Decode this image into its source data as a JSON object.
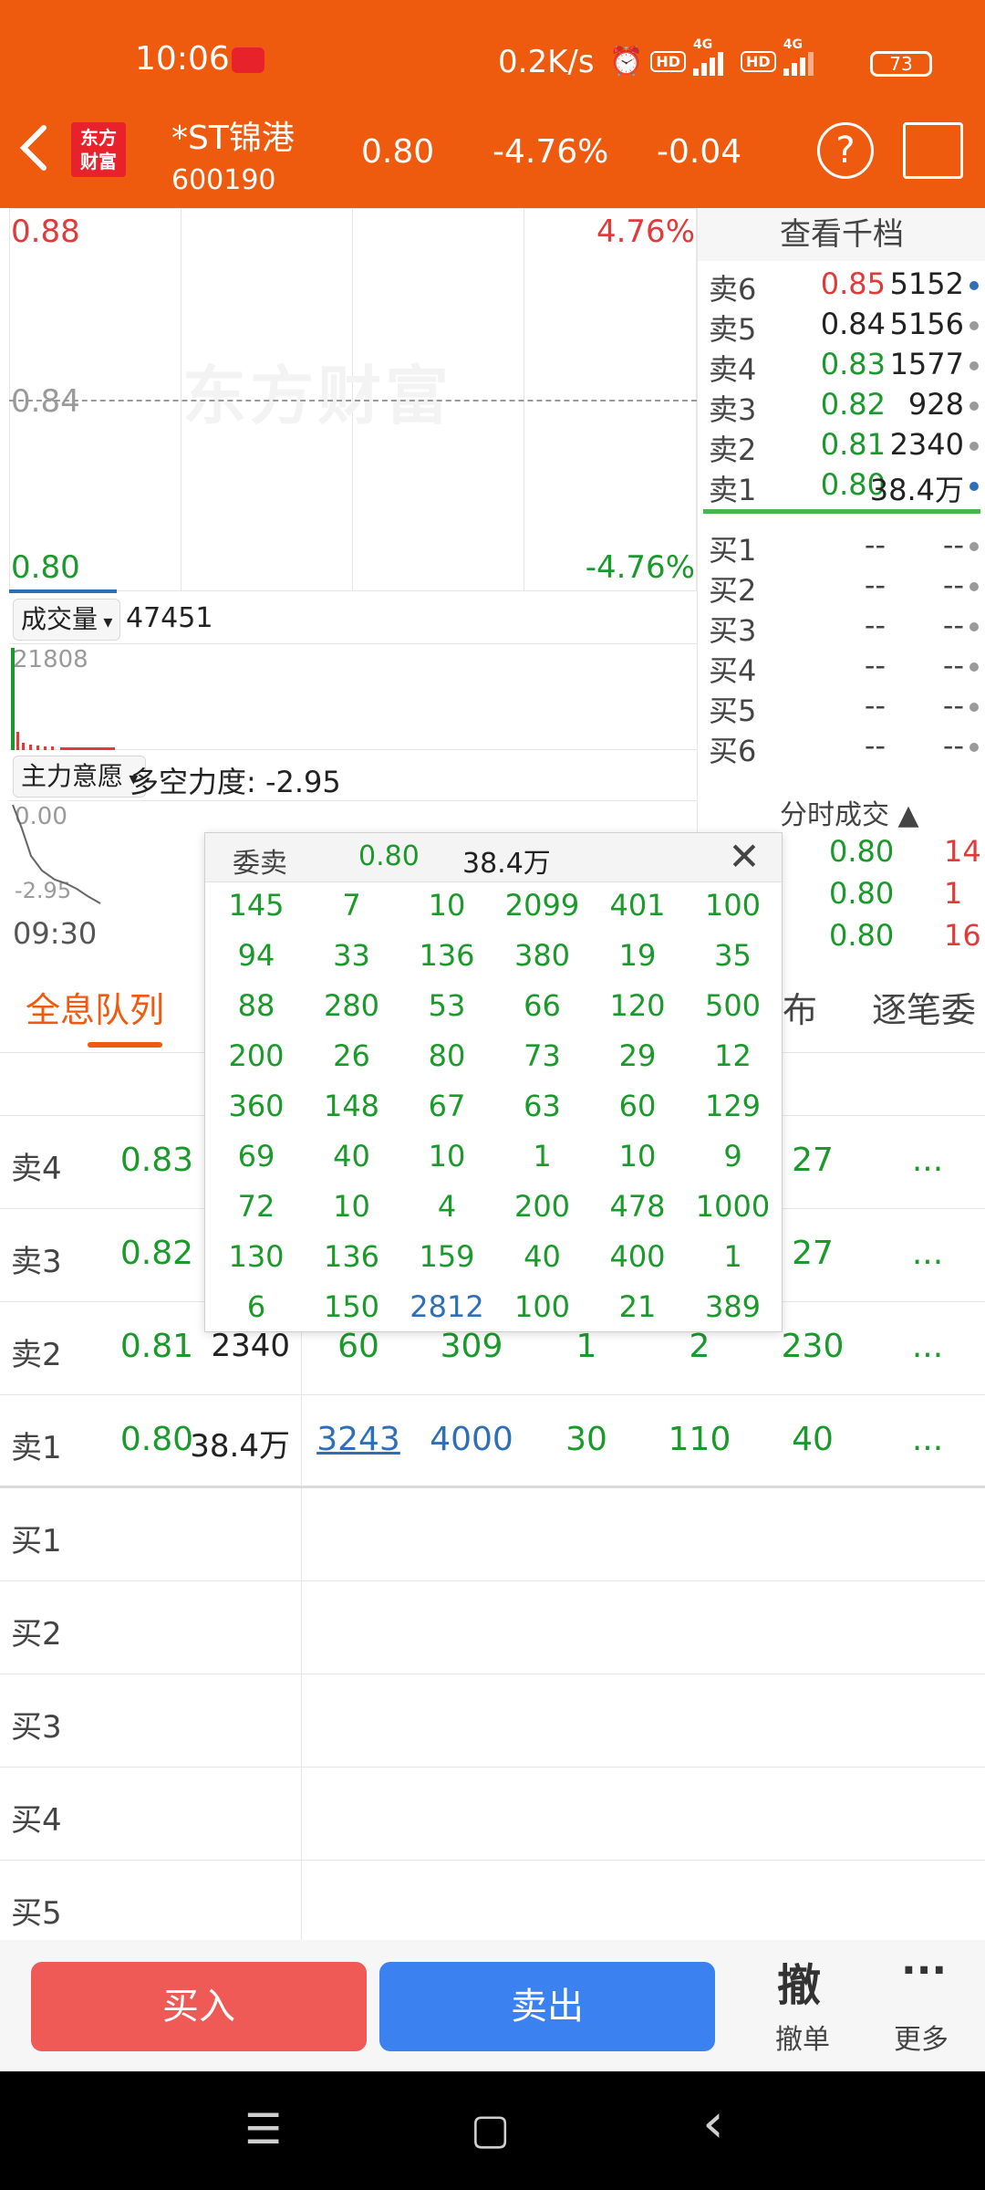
{
  "status": {
    "time": "10:06",
    "speed": "0.2K/s",
    "net1": "4G",
    "net2": "4G",
    "hd": "HD",
    "battery": "73"
  },
  "header": {
    "logo_line1": "东方",
    "logo_line2": "财富",
    "name": "*ST锦港",
    "code": "600190",
    "price": "0.80",
    "change_pct": "-4.76%",
    "change": "-0.04"
  },
  "chart": {
    "watermark": "东方财富",
    "y_top": "0.88",
    "y_mid": "0.84",
    "y_bottom": "0.80",
    "pct_top": "4.76%",
    "pct_bottom": "-4.76%",
    "volume_selector": "成交量",
    "volume_value": "47451",
    "volume_max": "21808",
    "force_selector": "主力意愿",
    "force_text": "多空力度: -2.95",
    "force_top": "0.00",
    "force_bottom": "-2.95",
    "time_start": "09:30"
  },
  "depth": {
    "title": "查看千档",
    "sells": [
      {
        "label": "卖6",
        "price": "0.85",
        "vol": "5152",
        "price_color": "#e03a3a",
        "dot": "#2f6fb6"
      },
      {
        "label": "卖5",
        "price": "0.84",
        "vol": "5156",
        "price_color": "#222222",
        "dot": "#9a9a9a"
      },
      {
        "label": "卖4",
        "price": "0.83",
        "vol": "1577",
        "price_color": "#1a9a2a",
        "dot": "#9a9a9a"
      },
      {
        "label": "卖3",
        "price": "0.82",
        "vol": "928",
        "price_color": "#1a9a2a",
        "dot": "#9a9a9a"
      },
      {
        "label": "卖2",
        "price": "0.81",
        "vol": "2340",
        "price_color": "#1a9a2a",
        "dot": "#9a9a9a"
      },
      {
        "label": "卖1",
        "price": "0.80",
        "vol": "38.4万",
        "price_color": "#1a9a2a",
        "dot": "#2f6fb6"
      }
    ],
    "buys": [
      {
        "label": "买1",
        "price": "--",
        "vol": "--"
      },
      {
        "label": "买2",
        "price": "--",
        "vol": "--"
      },
      {
        "label": "买3",
        "price": "--",
        "vol": "--"
      },
      {
        "label": "买4",
        "price": "--",
        "vol": "--"
      },
      {
        "label": "买5",
        "price": "--",
        "vol": "--"
      },
      {
        "label": "买6",
        "price": "--",
        "vol": "--"
      }
    ],
    "ticks_title": "分时成交 ▲",
    "ticks": [
      {
        "price": "0.80",
        "vol": "14"
      },
      {
        "price": "0.80",
        "vol": "1"
      },
      {
        "price": "0.80",
        "vol": "16"
      }
    ]
  },
  "tabs": {
    "queue": "全息队列",
    "dist": "布",
    "trades": "逐笔委"
  },
  "queue": {
    "rows": [
      {
        "label": "卖4",
        "price": "0.83",
        "vol": "",
        "cells": [
          "27",
          "..."
        ]
      },
      {
        "label": "卖3",
        "price": "0.82",
        "vol": "",
        "cells": [
          "27",
          "..."
        ]
      },
      {
        "label": "卖2",
        "price": "0.81",
        "vol": "2340",
        "cells": [
          "60",
          "309",
          "1",
          "2",
          "230",
          "..."
        ]
      },
      {
        "label": "卖1",
        "price": "0.80",
        "vol": "38.4万",
        "cells": [
          "3243",
          "4000",
          "30",
          "110",
          "40",
          "..."
        ]
      },
      {
        "label": "买1",
        "price": "",
        "vol": "",
        "cells": []
      },
      {
        "label": "买2",
        "price": "",
        "vol": "",
        "cells": []
      },
      {
        "label": "买3",
        "price": "",
        "vol": "",
        "cells": []
      },
      {
        "label": "买4",
        "price": "",
        "vol": "",
        "cells": []
      },
      {
        "label": "买5",
        "price": "",
        "vol": "",
        "cells": []
      }
    ]
  },
  "popup": {
    "label": "委卖",
    "price": "0.80",
    "volume": "38.4万",
    "grid": [
      [
        "145",
        "7",
        "10",
        "2099",
        "401",
        "100"
      ],
      [
        "94",
        "33",
        "136",
        "380",
        "19",
        "35"
      ],
      [
        "88",
        "280",
        "53",
        "66",
        "120",
        "500"
      ],
      [
        "200",
        "26",
        "80",
        "73",
        "29",
        "12"
      ],
      [
        "360",
        "148",
        "67",
        "63",
        "60",
        "129"
      ],
      [
        "69",
        "40",
        "10",
        "1",
        "10",
        "9"
      ],
      [
        "72",
        "10",
        "4",
        "200",
        "478",
        "1000"
      ],
      [
        "130",
        "136",
        "159",
        "40",
        "400",
        "1"
      ],
      [
        "6",
        "150",
        "2812",
        "100",
        "21",
        "389"
      ]
    ]
  },
  "bottom": {
    "buy": "买入",
    "sell": "卖出",
    "cancel_glyph": "撤",
    "cancel": "撤单",
    "more_glyph": "···",
    "more": "更多"
  },
  "nav": {
    "menu": "☰",
    "home": "▢",
    "back": "‹"
  }
}
